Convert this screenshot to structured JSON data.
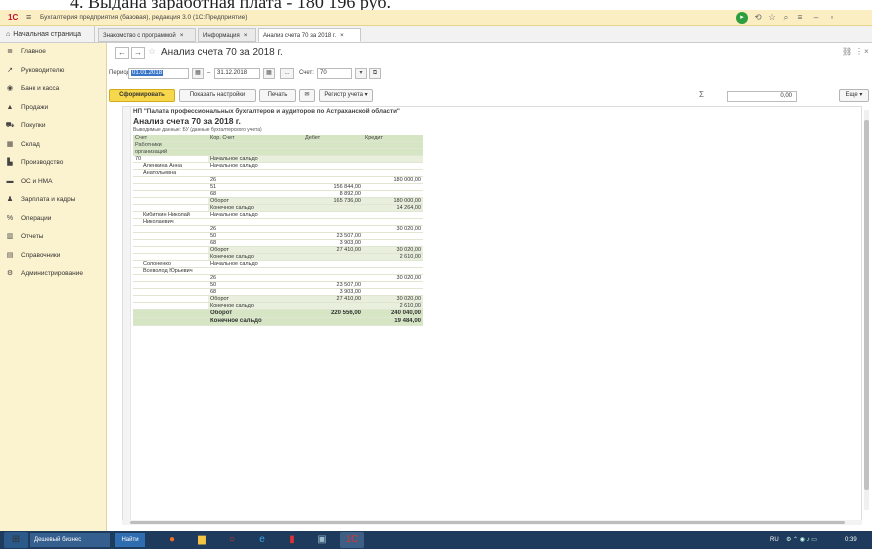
{
  "doc_top_text": "4. Выдана заработная плата - 180 196 руб.",
  "app": {
    "title": "Бухгалтерия предприятия (базовая), редакция 3.0  (1С:Предприятие)",
    "logo": "1С",
    "accent": "#f7d74b",
    "sidebar_bg": "#fbf2cf"
  },
  "tabs": {
    "home": "Начальная страница",
    "items": [
      {
        "label": "Знакомство с программой",
        "close": "×"
      },
      {
        "label": "Информация",
        "close": "×"
      },
      {
        "label": "Анализ счета 70 за 2018 г.",
        "close": "×"
      }
    ]
  },
  "sidebar": {
    "items": [
      {
        "label": "Главное",
        "icon": "menu-icon"
      },
      {
        "label": "Руководителю",
        "icon": "chart-icon"
      },
      {
        "label": "Банк и касса",
        "icon": "bank-icon"
      },
      {
        "label": "Продажи",
        "icon": "sales-icon"
      },
      {
        "label": "Покупки",
        "icon": "cart-icon"
      },
      {
        "label": "Склад",
        "icon": "warehouse-icon"
      },
      {
        "label": "Производство",
        "icon": "factory-icon"
      },
      {
        "label": "ОС и НМА",
        "icon": "truck-icon"
      },
      {
        "label": "Зарплата и кадры",
        "icon": "person-icon"
      },
      {
        "label": "Операции",
        "icon": "operations-icon"
      },
      {
        "label": "Отчеты",
        "icon": "reports-icon"
      },
      {
        "label": "Справочники",
        "icon": "book-icon"
      },
      {
        "label": "Администрирование",
        "icon": "gear-icon"
      }
    ]
  },
  "header": {
    "back": "←",
    "forward": "→",
    "title": "Анализ счета 70 за 2018 г."
  },
  "period": {
    "label": "Период:",
    "from": "01.01.2018",
    "dash": "–",
    "to": "31.12.2018",
    "dots": "...",
    "account_label": "Счет:",
    "account": "70"
  },
  "toolbar": {
    "generate": "Сформировать",
    "settings": "Показать настройки",
    "print": "Печать",
    "register": "Регистр учета",
    "sigma": "Σ",
    "sum_value": "0,00",
    "more": "Еще"
  },
  "report": {
    "org": "НП \"Палата профессиональных бухгалтеров и аудиторов по Астраханской области\"",
    "title": "Анализ счета 70 за 2018 г.",
    "subtitle": "Выводимые данные:  БУ (данные бухгалтерского учета)",
    "columns": [
      "Счет",
      "Кор. Счет",
      "Дебет",
      "Кредит"
    ],
    "columns_sub": [
      "Работники",
      "организаций"
    ],
    "rows": [
      {
        "a": "70",
        "b": "Начальное сальдо",
        "d": "",
        "k": "",
        "t": "sub"
      },
      {
        "a": "Аленкина Анна",
        "b": "Начальное сальдо",
        "d": "",
        "k": "",
        "t": "emp"
      },
      {
        "a": "Анатольевна",
        "b": "",
        "d": "",
        "k": "",
        "t": "emp"
      },
      {
        "a": "",
        "b": "26",
        "d": "",
        "k": "180 000,00",
        "t": ""
      },
      {
        "a": "",
        "b": "51",
        "d": "156 844,00",
        "k": "",
        "t": ""
      },
      {
        "a": "",
        "b": "68",
        "d": "8 892,00",
        "k": "",
        "t": ""
      },
      {
        "a": "",
        "b": "Оборот",
        "d": "165 736,00",
        "k": "180 000,00",
        "t": "sub"
      },
      {
        "a": "",
        "b": "Конечное сальдо",
        "d": "",
        "k": "14 264,00",
        "t": "sub"
      },
      {
        "a": "Кибиткин Николай",
        "b": "Начальное сальдо",
        "d": "",
        "k": "",
        "t": "emp"
      },
      {
        "a": "Николаевич",
        "b": "",
        "d": "",
        "k": "",
        "t": "emp"
      },
      {
        "a": "",
        "b": "26",
        "d": "",
        "k": "30 020,00",
        "t": ""
      },
      {
        "a": "",
        "b": "50",
        "d": "23 507,00",
        "k": "",
        "t": ""
      },
      {
        "a": "",
        "b": "68",
        "d": "3 903,00",
        "k": "",
        "t": ""
      },
      {
        "a": "",
        "b": "Оборот",
        "d": "27 410,00",
        "k": "30 020,00",
        "t": "sub"
      },
      {
        "a": "",
        "b": "Конечное сальдо",
        "d": "",
        "k": "2 610,00",
        "t": "sub"
      },
      {
        "a": "Солоненко",
        "b": "Начальное сальдо",
        "d": "",
        "k": "",
        "t": "emp"
      },
      {
        "a": "Всеволод Юрьевич",
        "b": "",
        "d": "",
        "k": "",
        "t": "emp"
      },
      {
        "a": "",
        "b": "26",
        "d": "",
        "k": "30 020,00",
        "t": ""
      },
      {
        "a": "",
        "b": "50",
        "d": "23 507,00",
        "k": "",
        "t": ""
      },
      {
        "a": "",
        "b": "68",
        "d": "3 903,00",
        "k": "",
        "t": ""
      },
      {
        "a": "",
        "b": "Оборот",
        "d": "27 410,00",
        "k": "30 020,00",
        "t": "sub"
      },
      {
        "a": "",
        "b": "Конечное сальдо",
        "d": "",
        "k": "2 610,00",
        "t": "sub"
      },
      {
        "a": "",
        "b": "Оборот",
        "d": "220 556,00",
        "k": "240 040,00",
        "t": "tot"
      },
      {
        "a": "",
        "b": "Конечное сальдо",
        "d": "",
        "k": "19 484,00",
        "t": "tot"
      }
    ]
  },
  "taskbar": {
    "browser_tab": "Дешевый бизнес",
    "search": "Найти",
    "lang": "RU",
    "time": "0:39"
  }
}
